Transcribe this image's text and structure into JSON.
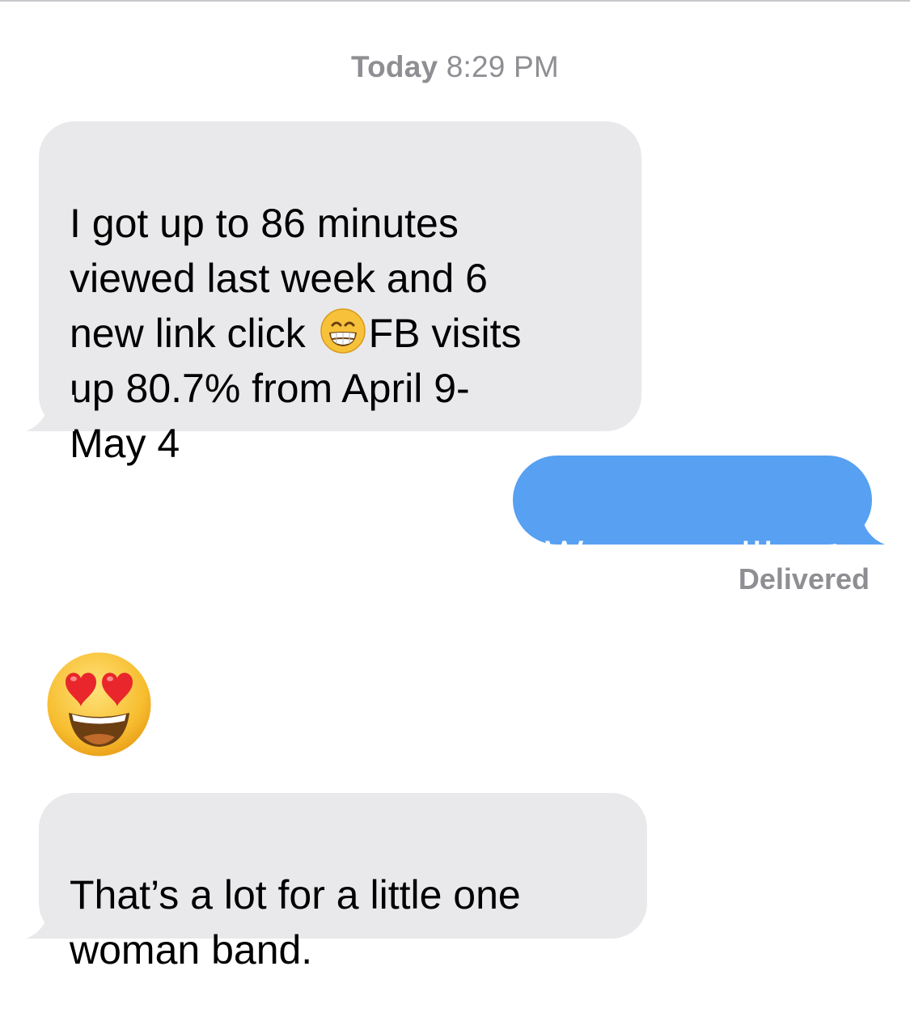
{
  "thread": {
    "timestamp_day": "Today",
    "timestamp_time": "8:29 PM"
  },
  "messages": [
    {
      "direction": "incoming",
      "text_part1": "I got up to 86 minutes\nviewed last week and 6\nnew link click ",
      "emoji": "grinning-face-with-smiling-eyes",
      "text_part2": "FB visits\nup 80.7% from April 9-\nMay 4"
    },
    {
      "direction": "outgoing",
      "text": "Wooooooo!!!",
      "status": "Delivered"
    },
    {
      "direction": "incoming",
      "emoji": "smiling-face-with-heart-eyes"
    },
    {
      "direction": "incoming",
      "text": "That’s a lot for a little one\nwoman band."
    }
  ],
  "colors": {
    "incoming_bubble": "#e9e9eb",
    "outgoing_bubble": "#57a0f2",
    "meta_text": "#8e8e93"
  }
}
